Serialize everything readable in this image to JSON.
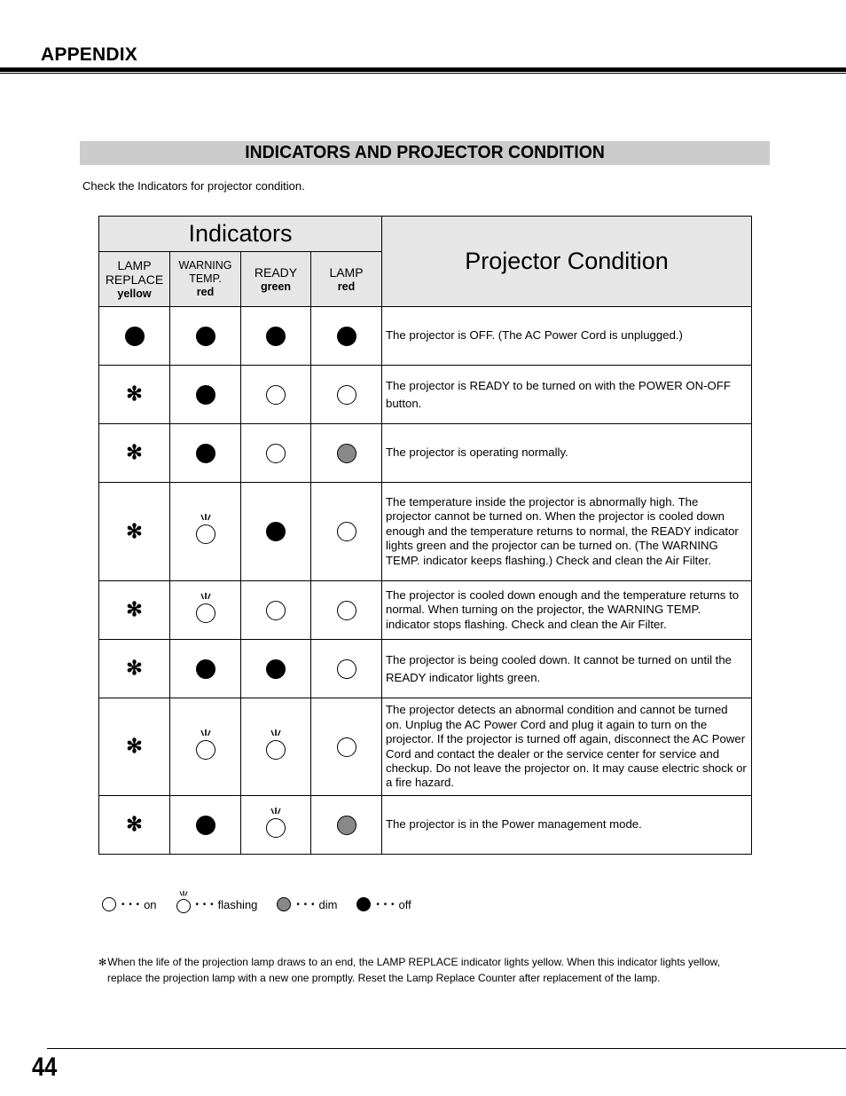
{
  "header": {
    "section": "APPENDIX"
  },
  "title": "INDICATORS AND PROJECTOR CONDITION",
  "intro": "Check the Indicators for projector condition.",
  "table": {
    "indicators_header": "Indicators",
    "condition_header": "Projector Condition",
    "columns": [
      {
        "line1": "LAMP",
        "line2": "REPLACE",
        "color": "yellow"
      },
      {
        "line1": "WARNING",
        "line2": "TEMP.",
        "color": "red"
      },
      {
        "line1": "READY",
        "line2": "",
        "color": "green"
      },
      {
        "line1": "LAMP",
        "line2": "",
        "color": "red"
      }
    ],
    "rows": [
      {
        "lamp_replace": "off",
        "warning_temp": "off",
        "ready": "off",
        "lamp": "off",
        "condition": "The projector is OFF.  (The AC Power Cord is unplugged.)"
      },
      {
        "lamp_replace": "star",
        "warning_temp": "off",
        "ready": "on",
        "lamp": "on",
        "condition": "The projector is READY to be turned on with the POWER ON-OFF button."
      },
      {
        "lamp_replace": "star",
        "warning_temp": "off",
        "ready": "on",
        "lamp": "dim",
        "condition": "The projector is operating normally."
      },
      {
        "lamp_replace": "star",
        "warning_temp": "flashing",
        "ready": "off",
        "lamp": "on",
        "condition": "The temperature inside the projector is abnormally high.  The projector cannot be turned on.  When  the projector is cooled down enough and the temperature returns to normal, the READY indicator lights green and the projector can be turned on.  (The WARNING TEMP. indicator keeps flashing.)  Check and clean the Air Filter."
      },
      {
        "lamp_replace": "star",
        "warning_temp": "flashing",
        "ready": "on",
        "lamp": "on",
        "condition": "The projector is cooled down enough and the temperature returns to normal.  When turning on the projector, the WARNING TEMP. indicator stops flashing.  Check and clean the Air Filter."
      },
      {
        "lamp_replace": "star",
        "warning_temp": "off",
        "ready": "off",
        "lamp": "on",
        "condition": "The projector is being cooled down. It cannot be turned on until the READY indicator lights green."
      },
      {
        "lamp_replace": "star",
        "warning_temp": "flashing",
        "ready": "flashing",
        "lamp": "on",
        "condition": "The projector detects an abnormal condition and cannot be turned on.  Unplug the AC Power Cord and plug it again to turn on the projector.  If the projector is turned off again, disconnect the AC Power Cord and contact the dealer or the service center for service and checkup.  Do not leave the projector on.  It may cause electric shock or a fire hazard."
      },
      {
        "lamp_replace": "star",
        "warning_temp": "off",
        "ready": "flashing",
        "lamp": "dim",
        "condition": "The projector is in the Power management mode."
      }
    ]
  },
  "legend": {
    "dots": "• • •",
    "items": [
      {
        "state": "on",
        "label": "on"
      },
      {
        "state": "flashing",
        "label": "flashing"
      },
      {
        "state": "dim",
        "label": "dim"
      },
      {
        "state": "off",
        "label": "off"
      }
    ]
  },
  "footnote": {
    "symbol": "✻",
    "line1": "When the life of the projection lamp draws to an end, the LAMP REPLACE indicator lights yellow.  When this indicator lights yellow,",
    "line2": "replace the projection lamp with a new one promptly.  Reset the Lamp Replace Counter after replacement of the lamp."
  },
  "page_number": "44",
  "colors": {
    "title_bar": "#cccccc",
    "header_bg": "#e6e6e6",
    "dim_led": "#888888"
  }
}
